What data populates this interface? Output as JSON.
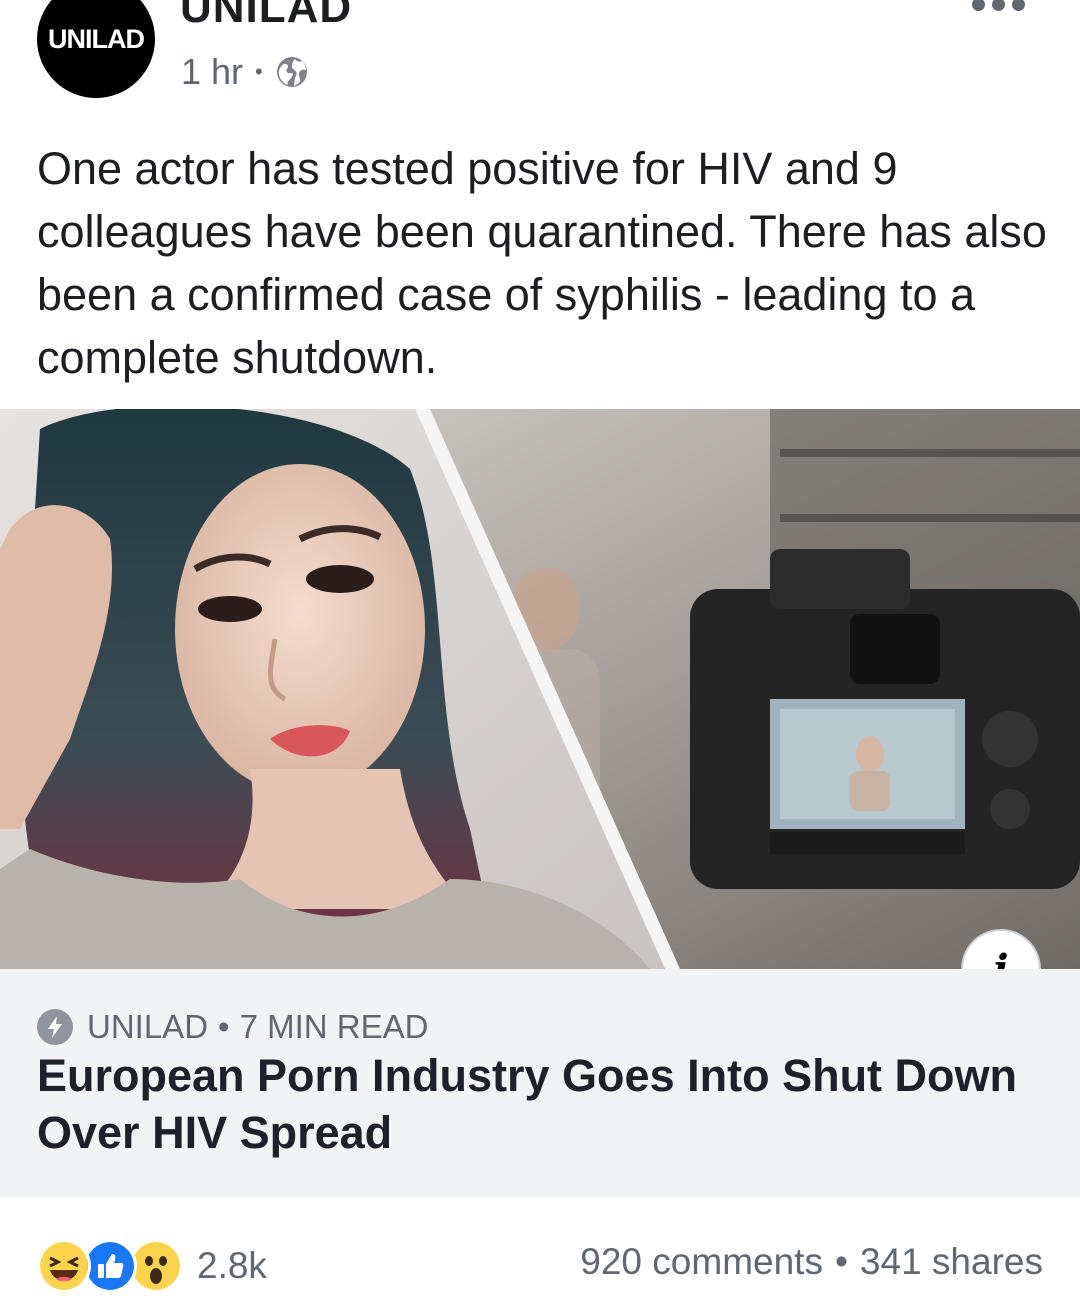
{
  "post": {
    "page_name": "UNILAD",
    "avatar_text": "UNILAD",
    "time": "1 hr",
    "separator": "•",
    "privacy_icon": "globe-icon",
    "more_icon": "more-options-icon",
    "text": "One actor has tested positive for HIV and 9 colleagues have been quarantined. There has also been a confirmed case of syphilis - leading to a complete shutdown."
  },
  "link": {
    "info_label": "i",
    "source": "UNILAD",
    "read_time": "7 MIN READ",
    "separator": "•",
    "source_icon": "lightning-bolt-icon",
    "headline": "European Porn Industry Goes Into Shut Down Over HIV Spread"
  },
  "engagement": {
    "reactions": [
      "haha-icon",
      "like-icon",
      "wow-icon"
    ],
    "reaction_count": "2.8k",
    "comments": "920 comments",
    "separator": "•",
    "shares": "341 shares"
  },
  "colors": {
    "avatar_bg": "#000000",
    "link_box_bg": "#f2f3f5",
    "meta_text": "#606770",
    "like_blue": "#1877f2",
    "reaction_yellow": "#fcd34d"
  }
}
